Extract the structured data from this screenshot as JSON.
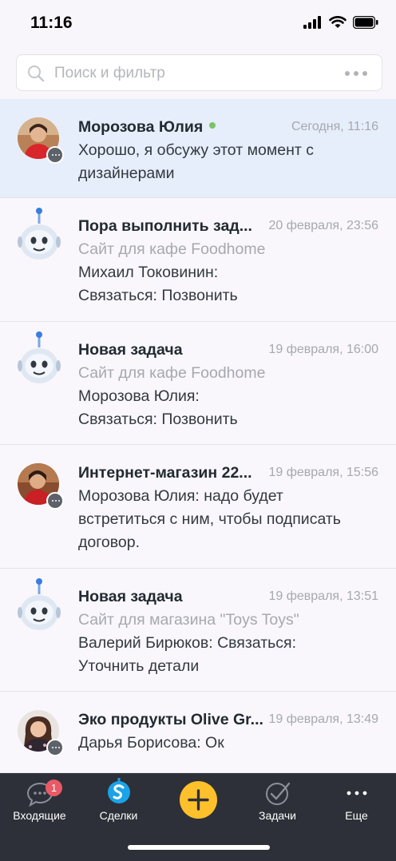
{
  "status_bar": {
    "time": "11:16"
  },
  "search": {
    "placeholder": "Поиск и фильтр"
  },
  "chats": [
    {
      "title": "Морозова Юлия",
      "date": "Сегодня, 11:16",
      "lines": [
        "Хорошо, я обсужу этот момент с",
        "дизайнерами"
      ],
      "online": true,
      "avatar": "person-photo"
    },
    {
      "title": "Пора выполнить зад...",
      "date": "20 февраля, 23:56",
      "subtitle": "Сайт для кафе Foodhome",
      "lines": [
        "Михаил Токовинин:",
        "Связаться: Позвонить"
      ],
      "avatar": "robot-icon"
    },
    {
      "title": "Новая задача",
      "date": "19 февраля, 16:00",
      "subtitle": "Сайт для кафе Foodhome",
      "lines": [
        "Морозова Юлия:",
        "Связаться: Позвонить"
      ],
      "avatar": "robot-icon"
    },
    {
      "title": "Интернет-магазин 22...",
      "date": "19 февраля, 15:56",
      "lines": [
        "Морозова Юлия: надо будет",
        "встретиться с ним, чтобы подписать",
        "договор."
      ],
      "avatar": "person-photo"
    },
    {
      "title": "Новая задача",
      "date": "19 февраля, 13:51",
      "subtitle": "Сайт для магазина \"Toys Toys\"",
      "lines": [
        "Валерий Бирюков: Связаться:",
        "Уточнить детали"
      ],
      "avatar": "robot-icon"
    },
    {
      "title": "Эко продукты Olive Gr...",
      "date": "19 февраля, 13:49",
      "lines": [
        "Дарья Борисова: Ок"
      ],
      "avatar": "person-photo"
    }
  ],
  "tabs": {
    "inbox": {
      "label": "Входящие",
      "badge": "1"
    },
    "deals": {
      "label": "Сделки"
    },
    "add": {
      "label": ""
    },
    "tasks": {
      "label": "Задачи"
    },
    "more": {
      "label": "Еще"
    }
  },
  "colors": {
    "accent": "#ffc12b",
    "active_row": "#e6eefb",
    "tab_bar": "#2d3038",
    "badge": "#e95a66",
    "online": "#7ac36a"
  }
}
